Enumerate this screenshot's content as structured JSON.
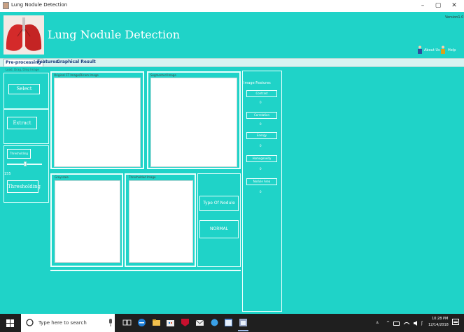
{
  "window": {
    "title": "Lung Nodule Detection",
    "minimize": "–",
    "maximize": "▢",
    "close": "✕"
  },
  "header": {
    "app_name": "Lung Nodule Detection",
    "version": "Version1.0",
    "about_label": "About Us",
    "help_label": "Help"
  },
  "tabs": [
    "Pre-processing",
    "Features",
    "Graphical Result"
  ],
  "left_panel": {
    "caption": "Load, Drag, Drop Image",
    "select_label": "Select",
    "extract_label": "Extract",
    "thresholding_small_label": "Thresholding",
    "slider_value_text": "155",
    "slider_fraction": 0.55,
    "thresholding_button_label": "Thresholding"
  },
  "panels": {
    "original": "Original CT Image/Dicom Image",
    "segmented": "Segmented Image",
    "greyscale": "Greyscale",
    "thresholded": "Thresholded Image"
  },
  "features": {
    "title": "Image Features",
    "items": [
      {
        "label": "Contrast",
        "value": "0"
      },
      {
        "label": "Correlation",
        "value": "0"
      },
      {
        "label": "Energy",
        "value": "0"
      },
      {
        "label": "Homogeneity",
        "value": "0"
      },
      {
        "label": "Nodule Area",
        "value": "0"
      }
    ]
  },
  "result": {
    "type_label": "Type Of Nodule",
    "value": "NORMAL"
  },
  "taskbar": {
    "search_placeholder": "Type here to search",
    "time": "10:28 PM",
    "date": "12/14/2018"
  },
  "colors": {
    "background": "#1fd3c8",
    "panel_border": "#e9fffd",
    "taskbar": "#1f1f1f",
    "accent_lung": "#d42a2a"
  }
}
